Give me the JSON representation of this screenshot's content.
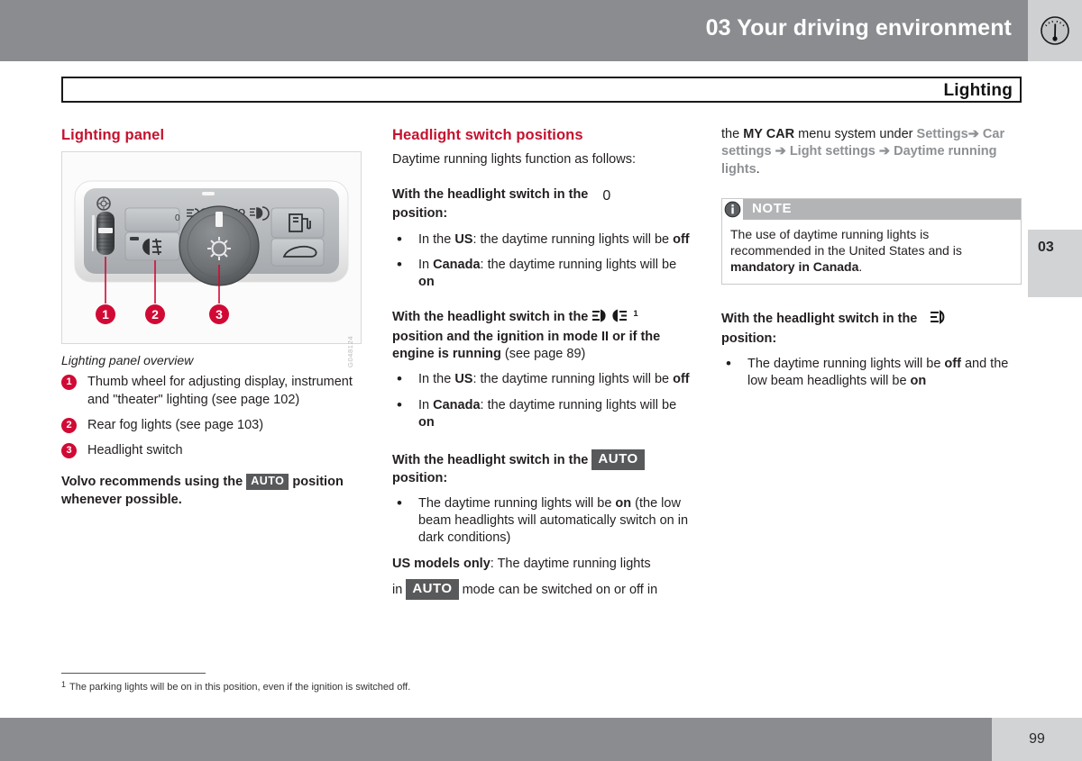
{
  "header": {
    "chapter_title": "03 Your driving environment",
    "icon": "gauge-icon",
    "band_color": "#8a8c8f",
    "icon_box_color": "#cfd0d1"
  },
  "running_head": {
    "label": "Lighting"
  },
  "chapter_tab": {
    "number": "03"
  },
  "left_column": {
    "section_title": "Lighting panel",
    "figure": {
      "alt": "lighting-panel-illustration",
      "watermark": "G048124",
      "callout_labels": [
        "1",
        "2",
        "3"
      ]
    },
    "figure_caption": "Lighting panel overview",
    "callouts": [
      {
        "num": "1",
        "text": "Thumb wheel for adjusting display, instrument and \"theater\" lighting (see page 102)"
      },
      {
        "num": "2",
        "text": "Rear fog lights (see page 103)"
      },
      {
        "num": "3",
        "text": "Headlight switch"
      }
    ],
    "recommend_prefix": "Volvo recommends using the ",
    "recommend_badge": "AUTO",
    "recommend_suffix": " position whenever possible."
  },
  "middle_column": {
    "section_title": "Headlight switch positions",
    "lead": "Daytime running lights function as follows:",
    "blocks": [
      {
        "heading_prefix": "With the headlight switch in the ",
        "symbol": "zero-position-symbol",
        "symbol_text": "0",
        "heading_suffix": "position:",
        "bullets": [
          {
            "prefix": "In the ",
            "bold1": "US",
            "mid": ": the daytime running lights will be ",
            "bold2": "off",
            "suffix": ""
          },
          {
            "prefix": "In ",
            "bold1": "Canada",
            "mid": ": the daytime running lights will be ",
            "bold2": "on",
            "suffix": ""
          }
        ]
      },
      {
        "heading_prefix": "With the headlight switch in the ",
        "symbol": "parking-lights-symbol",
        "footnote_marker": "1",
        "heading_suffix": "position and the ignition in mode II or if the engine is running",
        "heading_tail": " (see page 89)",
        "bullets": [
          {
            "prefix": "In the ",
            "bold1": "US",
            "mid": ": the daytime running lights will be ",
            "bold2": "off",
            "suffix": ""
          },
          {
            "prefix": "In ",
            "bold1": "Canada",
            "mid": ": the daytime running lights will be ",
            "bold2": "on",
            "suffix": ""
          }
        ]
      },
      {
        "heading_prefix": "With the headlight switch in the ",
        "symbol": "auto-badge",
        "symbol_text": "AUTO",
        "heading_suffix": "position:",
        "bullets": [
          {
            "prefix": "The daytime running lights will be ",
            "bold1": "on",
            "mid": " (the low beam headlights will automatically switch on in dark conditions)",
            "bold2": "",
            "suffix": ""
          }
        ]
      }
    ],
    "us_models_bold": "US models only",
    "us_models_text": ": The daytime running lights",
    "us_models_cont_prefix": "in ",
    "us_models_badge": "AUTO",
    "us_models_cont_suffix": " mode can be switched on or off in"
  },
  "right_column": {
    "continuation_prefix": "the ",
    "continuation_bold": "MY CAR",
    "continuation_mid": " menu system under ",
    "breadcrumb": [
      "Settings",
      "Car settings",
      "Light settings",
      "Daytime running lights"
    ],
    "breadcrumb_arrow": "➔",
    "breadcrumb_period": ".",
    "note": {
      "icon": "info-icon",
      "title": "NOTE",
      "text_prefix": "The use of daytime running lights is recommended in the United States and is ",
      "text_bold": "mandatory in Canada",
      "text_suffix": "."
    },
    "lowbeam_block": {
      "heading_prefix": "With the headlight switch in the ",
      "symbol": "low-beam-headlight-symbol",
      "heading_suffix": "position:",
      "bullets": [
        {
          "prefix": "The daytime running lights will be ",
          "bold1": "off",
          "mid": " and the low beam headlights will be ",
          "bold2": "on",
          "suffix": ""
        }
      ]
    }
  },
  "footnote": {
    "marker": "1",
    "text": "The parking lights will be on in this position, even if the ignition is switched off."
  },
  "footer": {
    "page_number": "99",
    "band_color": "#8a8c8f",
    "page_box_color": "#d2d3d4"
  },
  "colors": {
    "accent_red": "#c4122f",
    "callout_red": "#d10a35",
    "gray_breadcrumb": "#8e9194",
    "badge_gray": "#58595b",
    "note_head_gray": "#b2b4b6"
  }
}
